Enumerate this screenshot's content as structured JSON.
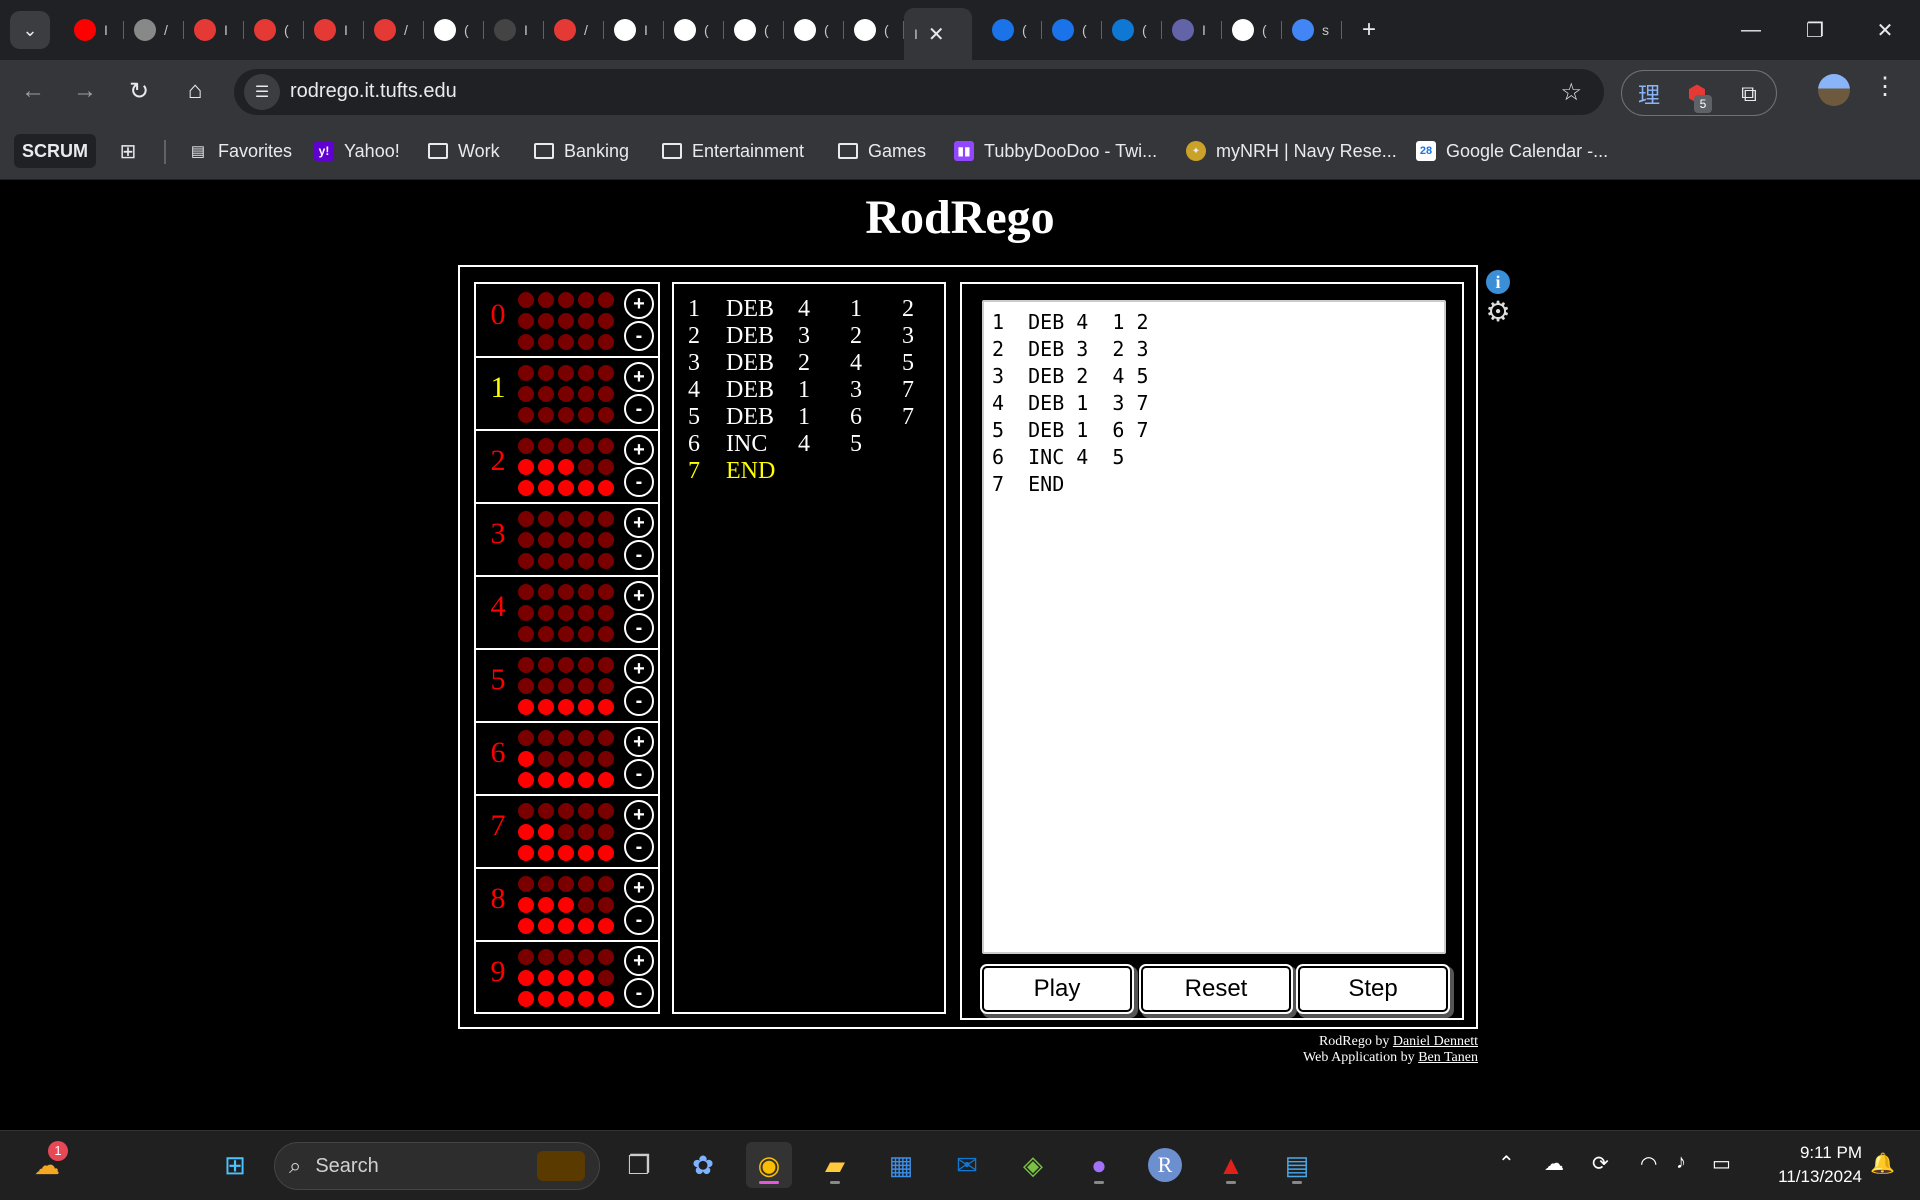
{
  "browser": {
    "tab_titles": [
      "I",
      "/",
      "I",
      "(",
      "I",
      "/",
      "(",
      "I",
      "/",
      "I",
      "(",
      "(",
      "(",
      "(",
      "I",
      "(",
      "(",
      "(",
      "I",
      "(",
      "s"
    ],
    "active_tab_close": "✕",
    "new_tab": "+",
    "url": "rodrego.it.tufts.edu",
    "extension_badge": "5",
    "bookmarks": {
      "scrum": "SCRUM",
      "favorites": "Favorites",
      "yahoo": "Yahoo!",
      "work": "Work",
      "banking": "Banking",
      "entertainment": "Entertainment",
      "games": "Games",
      "twitch": "TubbyDooDoo - Twi...",
      "mynrh": "myNRH | Navy Rese...",
      "gcal": "Google Calendar -..."
    }
  },
  "page": {
    "title": "RodRego",
    "registers": [
      {
        "label": "0",
        "count": 0,
        "active": false
      },
      {
        "label": "1",
        "count": 0,
        "active": true
      },
      {
        "label": "2",
        "count": 8,
        "active": false
      },
      {
        "label": "3",
        "count": 0,
        "active": false
      },
      {
        "label": "4",
        "count": 0,
        "active": false
      },
      {
        "label": "5",
        "count": 5,
        "active": false
      },
      {
        "label": "6",
        "count": 6,
        "active": false
      },
      {
        "label": "7",
        "count": 7,
        "active": false
      },
      {
        "label": "8",
        "count": 8,
        "active": false
      },
      {
        "label": "9",
        "count": 9,
        "active": false
      }
    ],
    "plus_label": "+",
    "minus_label": "-",
    "program": [
      {
        "line": "1",
        "op": "DEB",
        "a": "4",
        "b": "1",
        "c": "2",
        "active": false
      },
      {
        "line": "2",
        "op": "DEB",
        "a": "3",
        "b": "2",
        "c": "3",
        "active": false
      },
      {
        "line": "3",
        "op": "DEB",
        "a": "2",
        "b": "4",
        "c": "5",
        "active": false
      },
      {
        "line": "4",
        "op": "DEB",
        "a": "1",
        "b": "3",
        "c": "7",
        "active": false
      },
      {
        "line": "5",
        "op": "DEB",
        "a": "1",
        "b": "6",
        "c": "7",
        "active": false
      },
      {
        "line": "6",
        "op": "INC",
        "a": "4",
        "b": "5",
        "c": "",
        "active": false
      },
      {
        "line": "7",
        "op": "END",
        "a": "",
        "b": "",
        "c": "",
        "active": true
      }
    ],
    "editor_lines": [
      "1  DEB 4  1 2",
      "2  DEB 3  2 3",
      "3  DEB 2  4 5",
      "4  DEB 1  3 7",
      "5  DEB 1  6 7",
      "6  INC 4  5",
      "7  END"
    ],
    "buttons": {
      "play": "Play",
      "reset": "Reset",
      "step": "Step"
    },
    "info_icon": "i",
    "credits": {
      "line1_prefix": "RodRego by ",
      "line1_link": "Daniel Dennett",
      "line2_prefix": "Web Application by ",
      "line2_link": "Ben Tanen"
    }
  },
  "taskbar": {
    "search_placeholder": "Search",
    "weather_badge": "1",
    "time": "9:11 PM",
    "date": "11/13/2024"
  },
  "colors": {
    "register_on": "#ff0000",
    "register_off": "#7a0000",
    "active_yellow": "#ffff00"
  }
}
